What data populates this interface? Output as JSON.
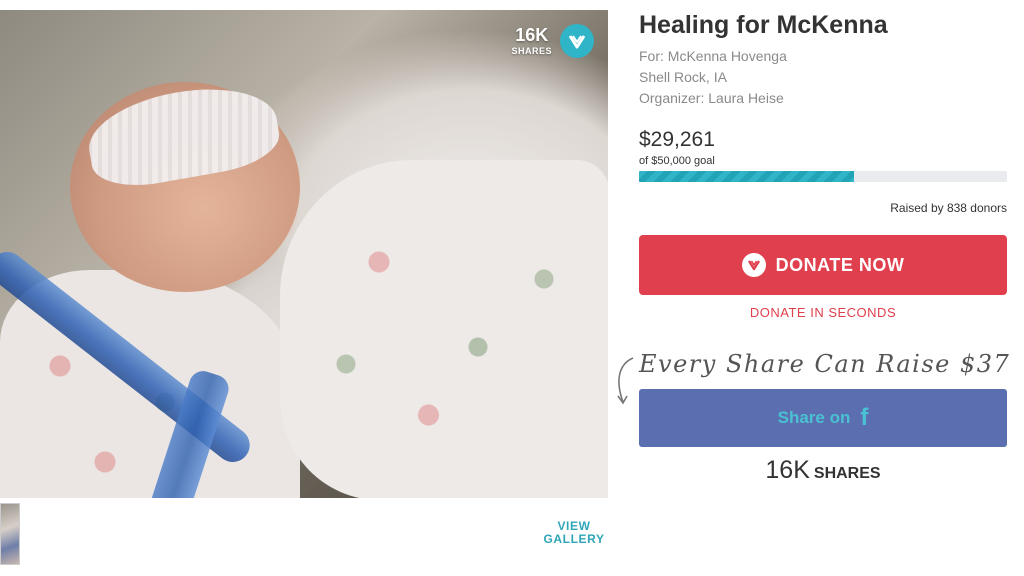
{
  "photo": {
    "share_count": "16K",
    "share_label": "SHARES"
  },
  "gallery": {
    "view_label_1": "VIEW",
    "view_label_2": "GALLERY"
  },
  "campaign": {
    "title": "Healing for McKenna",
    "for": "For: McKenna Hovenga",
    "location": "Shell Rock, IA",
    "organizer": "Organizer: Laura Heise",
    "amount_raised": "$29,261",
    "goal_text": "of $50,000 goal",
    "progress_fraction": 0.585,
    "donors_text": "Raised by 838 donors"
  },
  "actions": {
    "donate_label": "DONATE NOW",
    "donate_seconds_label": "DONATE IN SECONDS",
    "share_tagline": "Every Share Can Raise $37",
    "facebook_share_label": "Share on",
    "facebook_icon": "f",
    "shares_total_count": "16K",
    "shares_total_label": "SHARES"
  },
  "colors": {
    "brand_teal": "#2fb5c7",
    "donate_red": "#e0404d",
    "facebook_blue": "#5b6fb0"
  },
  "icons": [
    "gofundme-logo-icon",
    "donate-heart-icon",
    "curved-arrow-icon",
    "facebook-icon"
  ]
}
